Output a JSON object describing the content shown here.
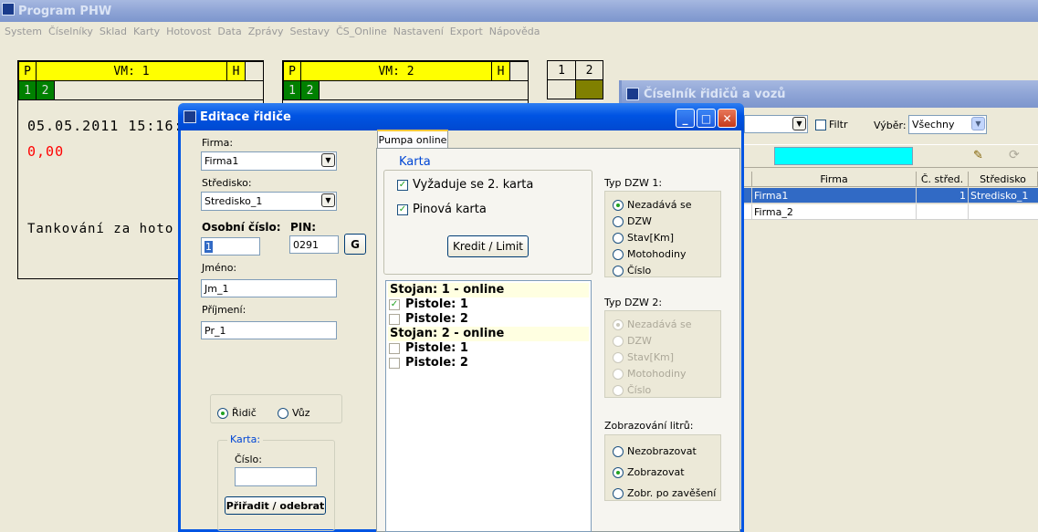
{
  "app": {
    "title": "Program PHW"
  },
  "menu": [
    "System",
    "Číselníky",
    "Sklad",
    "Karty",
    "Hotovost",
    "Data",
    "Zprávy",
    "Sestavy",
    "ČS_Online",
    "Nastavení",
    "Export",
    "Nápověda"
  ],
  "pumps": [
    {
      "p": "P",
      "vm": "VM: 1",
      "h": "H",
      "c1": "1",
      "c2": "2"
    },
    {
      "p": "P",
      "vm": "VM: 2",
      "h": "H",
      "c1": "1",
      "c2": "2"
    }
  ],
  "mini_pump": {
    "a": "1",
    "b": "2"
  },
  "pump_display": {
    "datetime": "05.05.2011 15:16:",
    "amount": "0,00",
    "message": "Tankování za hoto"
  },
  "ciselnik": {
    "title": "Číselník řidičů a vozů",
    "filter_label": "Filtr",
    "select_label": "Výběr:",
    "select_value": "Všechny",
    "columns": [
      "Firma",
      "Č. střed.",
      "Středisko"
    ],
    "rows": [
      {
        "firma": "Firma1",
        "stred": "1",
        "stredisko": "Stredisko_1"
      },
      {
        "firma": "Firma_2",
        "stred": "",
        "stredisko": ""
      }
    ]
  },
  "editace": {
    "title": "Editace řidiče",
    "firma_label": "Firma:",
    "firma_value": "Firma1",
    "stredisko_label": "Středisko:",
    "stredisko_value": "Stredisko_1",
    "osobni_label": "Osobní číslo:",
    "osobni_value": "1",
    "pin_label": "PIN:",
    "pin_value": "0291",
    "g_label": "G",
    "jmeno_label": "Jméno:",
    "jmeno_value": "Jm_1",
    "prijmeni_label": "Příjmení:",
    "prijmeni_value": "Pr_1",
    "ridic_label": "Řidič",
    "vuz_label": "Vůz",
    "karta_group": "Karta:",
    "cislo_label": "Číslo:",
    "cislo_value": "",
    "assign_button": "Přiřadit / odebrat",
    "tab_label": "Pumpa online",
    "karta_title": "Karta",
    "vyzaduje_label": "Vyžaduje se 2. karta",
    "pinova_label": "Pinová karta",
    "kredit_button": "Kredit / Limit",
    "stojany": [
      {
        "type": "header",
        "text": "Stojan: 1  - online"
      },
      {
        "type": "item",
        "text": "Pistole: 1",
        "checked": true
      },
      {
        "type": "item",
        "text": "Pistole: 2",
        "checked": false
      },
      {
        "type": "header",
        "text": "Stojan: 2  - online"
      },
      {
        "type": "item",
        "text": "Pistole: 1",
        "checked": false
      },
      {
        "type": "item",
        "text": "Pistole: 2",
        "checked": false
      }
    ],
    "dzw1_label": "Typ DZW 1:",
    "dzw1_options": [
      "Nezadává se",
      "DZW",
      "Stav[Km]",
      "Motohodiny",
      "Číslo"
    ],
    "dzw2_label": "Typ DZW 2:",
    "dzw2_options": [
      "Nezadává se",
      "DZW",
      "Stav[Km]",
      "Motohodiny",
      "Číslo"
    ],
    "litru_label": "Zobrazování litrů:",
    "litru_options": [
      "Nezobrazovat",
      "Zobrazovat",
      "Zobr. po zavěšení"
    ]
  },
  "colors": {
    "accent": "#0054e3",
    "selection": "#316ac5",
    "cyan": "#00ffff",
    "yellow": "#ffff00",
    "green": "#008000",
    "red": "#ff0000"
  }
}
